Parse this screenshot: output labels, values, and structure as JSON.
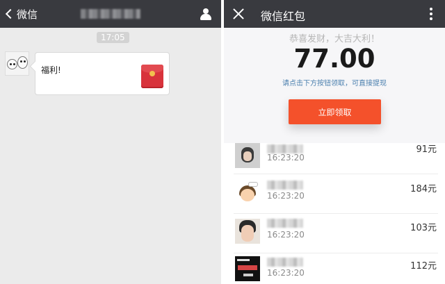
{
  "chat": {
    "back_label": "微信",
    "time": "17:05",
    "message_text": "福利!"
  },
  "redpacket": {
    "title": "微信红包",
    "greeting": "恭喜发财，大吉大利！",
    "amount": "77.00",
    "hint": "请点击下方按钮领取，可直接提现",
    "claim_label": "立即领取",
    "records": [
      {
        "time": "16:23:20",
        "amount": "91元"
      },
      {
        "time": "16:23:20",
        "amount": "184元"
      },
      {
        "time": "16:23:20",
        "amount": "103元"
      },
      {
        "time": "16:23:20",
        "amount": "112元"
      }
    ]
  },
  "colors": {
    "topbar": "#393a3f",
    "chat_bg": "#ebebeb",
    "claim_button": "#f4512b",
    "hint_text": "#4a7fae",
    "red_packet": "#d8323b"
  },
  "icons": [
    "chevron-left-icon",
    "user-icon",
    "red-packet-icon",
    "close-icon",
    "more-vertical-icon"
  ]
}
